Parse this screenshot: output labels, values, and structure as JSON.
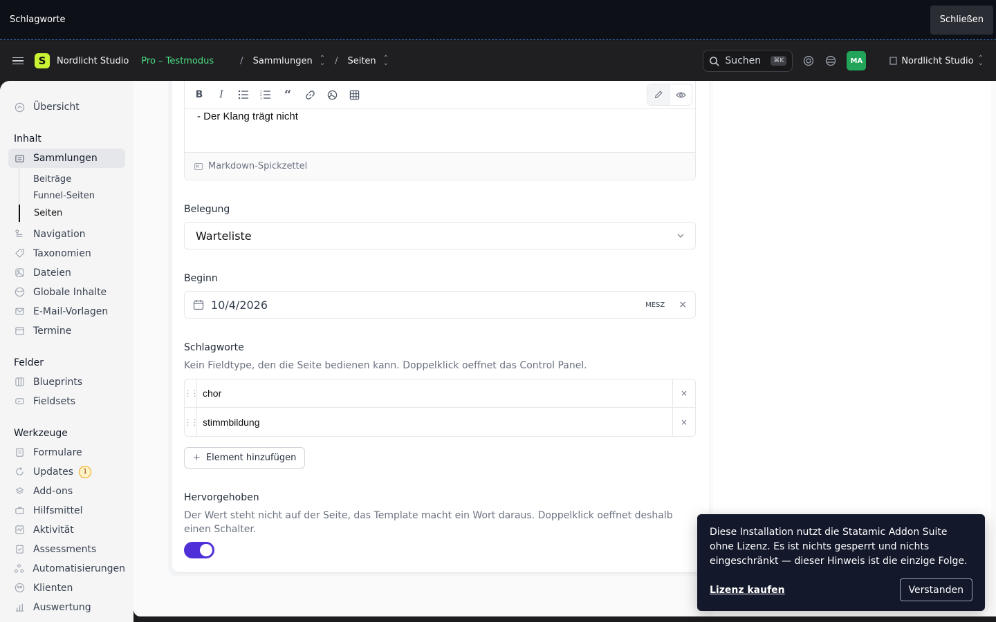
{
  "topbar": {
    "title": "Schlagworte",
    "close_label": "Schließen"
  },
  "header": {
    "site_name": "Nordlicht Studio",
    "plan": "Pro – Testmodus",
    "crumb_1": "Sammlungen",
    "crumb_2": "Seiten",
    "search_label": "Suchen",
    "search_kbd": "⌘K",
    "avatar_initials": "MA",
    "site_switch": "Nordlicht Studio"
  },
  "sidebar": {
    "overview": "Übersicht",
    "section_content": "Inhalt",
    "collections": "Sammlungen",
    "collection_items": [
      "Beiträge",
      "Funnel-Seiten",
      "Seiten"
    ],
    "content_items": [
      "Navigation",
      "Taxonomien",
      "Dateien",
      "Globale Inhalte",
      "E-Mail-Vorlagen",
      "Termine"
    ],
    "section_fields": "Felder",
    "field_items": [
      "Blueprints",
      "Fieldsets"
    ],
    "section_tools": "Werkzeuge",
    "tool_items": [
      "Formulare",
      "Updates",
      "Add-ons",
      "Hilfsmittel",
      "Aktivität",
      "Assessments",
      "Automatisierungen",
      "Klienten",
      "Auswertung"
    ],
    "updates_badge": "1"
  },
  "editor": {
    "content": "- Der Klang trägt nicht",
    "footer": "Markdown-Spickzettel"
  },
  "belegung": {
    "label": "Belegung",
    "value": "Warteliste"
  },
  "beginn": {
    "label": "Beginn",
    "value": "10/4/2026",
    "timezone": "MESZ"
  },
  "schlagworte": {
    "label": "Schlagworte",
    "help": "Kein Fieldtype, den die Seite bedienen kann. Doppelklick oeffnet das Control Panel.",
    "items": [
      "chor",
      "stimmbildung"
    ],
    "add_label": "Element hinzufügen"
  },
  "hervorgehoben": {
    "label": "Hervorgehoben",
    "help": "Der Wert steht nicht auf der Seite, das Template macht ein Wort daraus. Doppelklick oeffnet deshalb einen Schalter.",
    "enabled": true
  },
  "notice": {
    "text": "Diese Installation nutzt die Statamic Addon Suite ohne Lizenz. Es ist nichts gesperrt und nichts eingeschränkt — dieser Hinweis ist die einzige Folge.",
    "buy_label": "Lizenz kaufen",
    "ok_label": "Verstanden"
  },
  "colors": {
    "accent": "#4f2fd8",
    "brand": "#c9f233",
    "plan_green": "#4ade80"
  }
}
